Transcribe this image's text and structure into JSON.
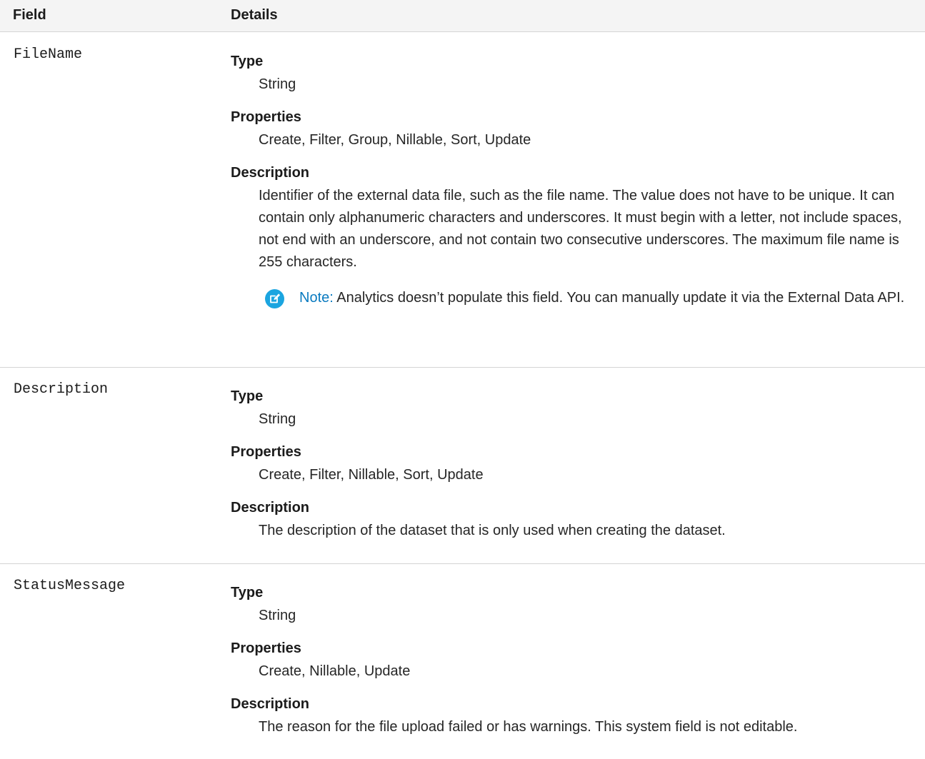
{
  "header": {
    "field_label": "Field",
    "details_label": "Details"
  },
  "rows": [
    {
      "field": "FileName",
      "type_label": "Type",
      "type_value": "String",
      "properties_label": "Properties",
      "properties_value": "Create, Filter, Group, Nillable, Sort, Update",
      "description_label": "Description",
      "description_value": "Identifier of the external data file, such as the file name. The value does not have to be unique. It can contain only alphanumeric characters and underscores. It must begin with a letter, not include spaces, not end with an underscore, and not contain two consecutive underscores. The maximum file name is 255 characters.",
      "note_label": "Note:",
      "note_text": "Analytics doesn’t populate this field. You can manually update it via the External Data API."
    },
    {
      "field": "Description",
      "type_label": "Type",
      "type_value": "String",
      "properties_label": "Properties",
      "properties_value": "Create, Filter, Nillable, Sort, Update",
      "description_label": "Description",
      "description_value": "The description of the dataset that is only used when creating the dataset."
    },
    {
      "field": "StatusMessage",
      "type_label": "Type",
      "type_value": "String",
      "properties_label": "Properties",
      "properties_value": "Create, Nillable, Update",
      "description_label": "Description",
      "description_value": "The reason for the file upload failed or has warnings. This system field is not editable."
    }
  ],
  "icons": {
    "note": "edit-note-icon"
  },
  "colors": {
    "header_bg": "#f4f4f4",
    "note_accent": "#0b7bc0",
    "note_icon_bg": "#1ba5e0"
  }
}
